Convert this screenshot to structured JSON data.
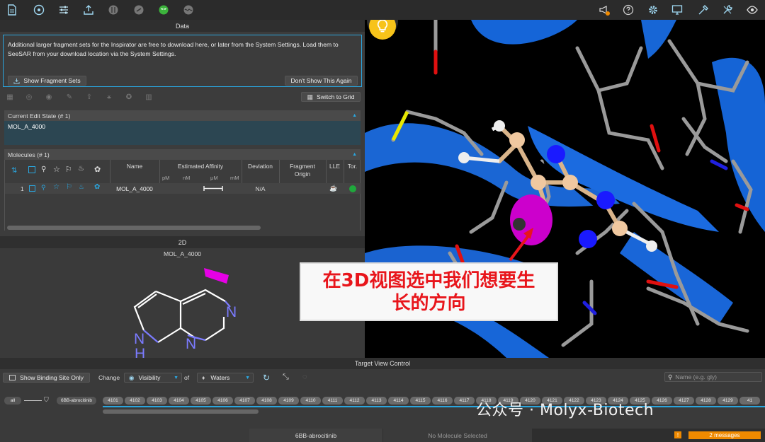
{
  "toolbar": {
    "left_icons": [
      "document-icon",
      "target-icon",
      "sliders-icon",
      "upload-icon",
      "molecule-icon",
      "link-icon",
      "sprout-icon",
      "wave-icon"
    ],
    "right_icons": [
      "notification-icon",
      "help-icon",
      "gear-icon",
      "monitor-icon",
      "tools-icon",
      "wrench-icon",
      "eye-icon"
    ]
  },
  "data_panel": {
    "header": "Data",
    "notice_text": "Additional larger fragment sets for the Inspirator are free to download here, or later from the System Settings. Load them to SeeSAR from your download location via the System Settings.",
    "show_fragment_sets": "Show Fragment Sets",
    "dont_show_again": "Don't Show This Again",
    "switch_to_grid": "Switch to Grid",
    "current_edit_state": "Current Edit State  (# 1)",
    "current_molecule": "MOL_A_4000",
    "molecules_header": "Molecules  (# 1)",
    "columns": {
      "name": "Name",
      "estimated_affinity": "Estimated Affinity",
      "deviation": "Deviation",
      "fragment_origin": "Fragment Origin",
      "lle": "LLE",
      "tor": "Tor.",
      "units": [
        "pM",
        "nM",
        "μM",
        "mM"
      ]
    },
    "row": {
      "index": "1",
      "name": "MOL_A_4000",
      "deviation": "N/A"
    }
  },
  "panel_2d": {
    "header": "2D",
    "molecule_title": "MOL_A_4000",
    "atom_n1": "N",
    "atom_n2": "N",
    "atom_nh_n": "N",
    "atom_nh_h": "H"
  },
  "view3d": {
    "overlay_line1": "在3D视图选中我们想要生",
    "overlay_line2": "长的方向"
  },
  "target_view_control": {
    "header": "Target View Control",
    "show_binding_site_only": "Show Binding Site Only",
    "change": "Change",
    "visibility": "Visibility",
    "of": "of",
    "waters": "Waters",
    "search_placeholder": "Name (e.g. gly)",
    "filter_all": "all",
    "chain_label": "6BB-abrocitinib",
    "residues": [
      "4101",
      "4102",
      "4103",
      "4104",
      "4105",
      "4106",
      "4107",
      "4108",
      "4109",
      "4110",
      "4111",
      "4112",
      "4113",
      "4114",
      "4115",
      "4116",
      "4117",
      "4118",
      "4119",
      "4120",
      "4121",
      "4122",
      "4123",
      "4124",
      "4125",
      "4126",
      "4127",
      "4128",
      "4129",
      "41"
    ]
  },
  "statusbar": {
    "structure": "6BB-abrocitinib",
    "molecule_status": "No Molecule Selected",
    "messages": "2 messages",
    "warning_badge": "!"
  },
  "watermark": "公众号 · Molyx-Biotech",
  "colors": {
    "accent": "#2aa6df",
    "highlight": "#e600e6",
    "messages": "#f08a00",
    "overlay_text": "#e8151b"
  }
}
